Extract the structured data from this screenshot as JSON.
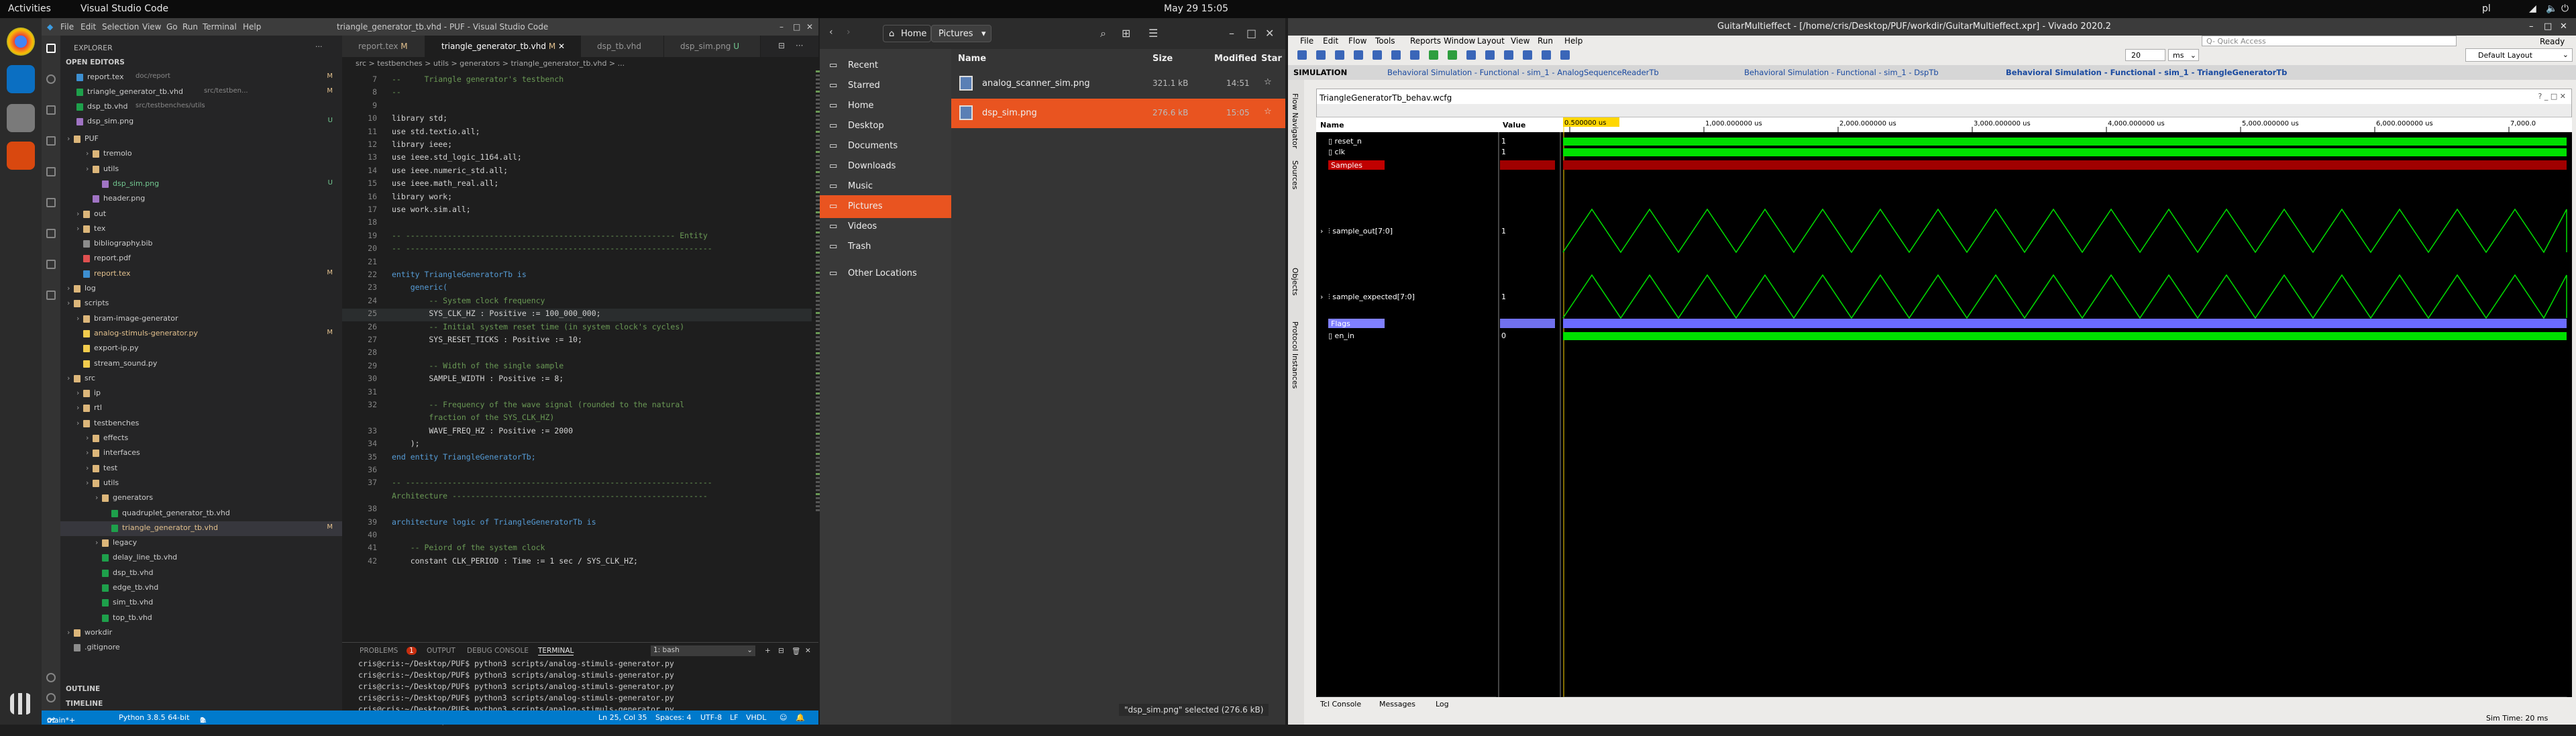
{
  "topbar": {
    "activities": "Activities",
    "app": "Visual Studio Code",
    "clock": "May 29  15:05",
    "locale": "pl"
  },
  "vscode": {
    "title": "triangle_generator_tb.vhd - PUF - Visual Studio Code",
    "menu": [
      "File",
      "Edit",
      "Selection",
      "View",
      "Go",
      "Run",
      "Terminal",
      "Help"
    ],
    "sidebar_title": "EXPLORER",
    "open_editors_header": "OPEN EDITORS",
    "open_editors": [
      {
        "name": "report.tex",
        "path": "doc/report",
        "badge": "M"
      },
      {
        "name": "triangle_generator_tb.vhd",
        "path": "src/testben...",
        "badge": "M"
      },
      {
        "name": "dsp_tb.vhd",
        "path": "src/testbenches/utils",
        "badge": ""
      },
      {
        "name": "dsp_sim.png",
        "path": "",
        "badge": "U"
      }
    ],
    "tree": [
      {
        "label": "PUF",
        "depth": 0,
        "kind": "folder"
      },
      {
        "label": "tremolo",
        "depth": 2,
        "kind": "folder"
      },
      {
        "label": "utils",
        "depth": 2,
        "kind": "folder"
      },
      {
        "label": "dsp_sim.png",
        "depth": 3,
        "kind": "png",
        "badge": "U"
      },
      {
        "label": "header.png",
        "depth": 2,
        "kind": "png"
      },
      {
        "label": "out",
        "depth": 1,
        "kind": "folder"
      },
      {
        "label": "tex",
        "depth": 1,
        "kind": "folder"
      },
      {
        "label": "bibliography.bib",
        "depth": 1,
        "kind": "file"
      },
      {
        "label": "report.pdf",
        "depth": 1,
        "kind": "pdf"
      },
      {
        "label": "report.tex",
        "depth": 1,
        "kind": "tex",
        "badge": "M"
      },
      {
        "label": "log",
        "depth": 0,
        "kind": "folder"
      },
      {
        "label": "scripts",
        "depth": 0,
        "kind": "folder"
      },
      {
        "label": "bram-image-generator",
        "depth": 1,
        "kind": "folder"
      },
      {
        "label": "analog-stimuls-generator.py",
        "depth": 1,
        "kind": "py",
        "badge": "M"
      },
      {
        "label": "export-ip.py",
        "depth": 1,
        "kind": "py"
      },
      {
        "label": "stream_sound.py",
        "depth": 1,
        "kind": "py"
      },
      {
        "label": "src",
        "depth": 0,
        "kind": "folder"
      },
      {
        "label": "ip",
        "depth": 1,
        "kind": "folder"
      },
      {
        "label": "rtl",
        "depth": 1,
        "kind": "folder"
      },
      {
        "label": "testbenches",
        "depth": 1,
        "kind": "folder"
      },
      {
        "label": "effects",
        "depth": 2,
        "kind": "folder"
      },
      {
        "label": "interfaces",
        "depth": 2,
        "kind": "folder"
      },
      {
        "label": "test",
        "depth": 2,
        "kind": "folder"
      },
      {
        "label": "utils",
        "depth": 2,
        "kind": "folder"
      },
      {
        "label": "generators",
        "depth": 3,
        "kind": "folder"
      },
      {
        "label": "quadruplet_generator_tb.vhd",
        "depth": 4,
        "kind": "vhd"
      },
      {
        "label": "triangle_generator_tb.vhd",
        "depth": 4,
        "kind": "vhd",
        "badge": "M",
        "selected": true
      },
      {
        "label": "legacy",
        "depth": 3,
        "kind": "folder"
      },
      {
        "label": "delay_line_tb.vhd",
        "depth": 3,
        "kind": "vhd"
      },
      {
        "label": "dsp_tb.vhd",
        "depth": 3,
        "kind": "vhd"
      },
      {
        "label": "edge_tb.vhd",
        "depth": 3,
        "kind": "vhd"
      },
      {
        "label": "sim_tb.vhd",
        "depth": 3,
        "kind": "vhd"
      },
      {
        "label": "top_tb.vhd",
        "depth": 3,
        "kind": "vhd"
      },
      {
        "label": "workdir",
        "depth": 0,
        "kind": "folder"
      },
      {
        "label": ".gitignore",
        "depth": 0,
        "kind": "file"
      }
    ],
    "outline": "OUTLINE",
    "timeline": "TIMELINE",
    "tabs": [
      {
        "label": "report.tex",
        "mod": "M"
      },
      {
        "label": "triangle_generator_tb.vhd",
        "mod": "M",
        "active": true
      },
      {
        "label": "dsp_tb.vhd",
        "mod": ""
      },
      {
        "label": "dsp_sim.png",
        "mod": "U"
      }
    ],
    "breadcrumb": "src > testbenches > utils > generators > triangle_generator_tb.vhd > ...",
    "code": [
      {
        "n": "7",
        "t": "--     Triangle generator's testbench",
        "c": "cm"
      },
      {
        "n": "8",
        "t": "--",
        "c": "cm"
      },
      {
        "n": "9",
        "t": "",
        "c": "tx"
      },
      {
        "n": "10",
        "t": "library std;",
        "c": "tx"
      },
      {
        "n": "11",
        "t": "use std.textio.all;",
        "c": "tx"
      },
      {
        "n": "12",
        "t": "library ieee;",
        "c": "tx"
      },
      {
        "n": "13",
        "t": "use ieee.std_logic_1164.all;",
        "c": "tx"
      },
      {
        "n": "14",
        "t": "use ieee.numeric_std.all;",
        "c": "tx"
      },
      {
        "n": "15",
        "t": "use ieee.math_real.all;",
        "c": "tx"
      },
      {
        "n": "16",
        "t": "library work;",
        "c": "tx"
      },
      {
        "n": "17",
        "t": "use work.sim.all;",
        "c": "tx"
      },
      {
        "n": "18",
        "t": "",
        "c": "tx"
      },
      {
        "n": "19",
        "t": "-- ---------------------------------------------------------- Entity",
        "c": "cm"
      },
      {
        "n": "20",
        "t": "-- ------------------------------------------------------------------",
        "c": "cm"
      },
      {
        "n": "21",
        "t": "",
        "c": "tx"
      },
      {
        "n": "22",
        "t": "entity TriangleGeneratorTb is",
        "c": "kw"
      },
      {
        "n": "23",
        "t": "    generic(",
        "c": "kw"
      },
      {
        "n": "24",
        "t": "        -- System clock frequency",
        "c": "cm"
      },
      {
        "n": "25",
        "t": "        SYS_CLK_HZ : Positive := 100_000_000;",
        "c": "tx"
      },
      {
        "n": "26",
        "t": "        -- Initial system reset time (in system clock's cycles)",
        "c": "cm"
      },
      {
        "n": "27",
        "t": "        SYS_RESET_TICKS : Positive := 10;",
        "c": "tx"
      },
      {
        "n": "28",
        "t": "",
        "c": "tx"
      },
      {
        "n": "29",
        "t": "        -- Width of the single sample",
        "c": "cm"
      },
      {
        "n": "30",
        "t": "        SAMPLE_WIDTH : Positive := 8;",
        "c": "tx"
      },
      {
        "n": "31",
        "t": "",
        "c": "tx"
      },
      {
        "n": "32",
        "t": "        -- Frequency of the wave signal (rounded to the natural",
        "c": "cm"
      },
      {
        "n": "",
        "t": "        fraction of the SYS_CLK_HZ)",
        "c": "cm"
      },
      {
        "n": "33",
        "t": "        WAVE_FREQ_HZ : Positive := 2000",
        "c": "tx"
      },
      {
        "n": "34",
        "t": "    );",
        "c": "tx"
      },
      {
        "n": "35",
        "t": "end entity TriangleGeneratorTb;",
        "c": "kw"
      },
      {
        "n": "36",
        "t": "",
        "c": "tx"
      },
      {
        "n": "37",
        "t": "-- ------------------------------------------------------------------",
        "c": "cm"
      },
      {
        "n": "",
        "t": "Architecture -------------------------------------------------------",
        "c": "cm"
      },
      {
        "n": "38",
        "t": "",
        "c": "tx"
      },
      {
        "n": "39",
        "t": "architecture logic of TriangleGeneratorTb is",
        "c": "kw"
      },
      {
        "n": "40",
        "t": "",
        "c": "tx"
      },
      {
        "n": "41",
        "t": "    -- Peiord of the system clock",
        "c": "cm"
      },
      {
        "n": "42",
        "t": "    constant CLK_PERIOD : Time := 1 sec / SYS_CLK_HZ;",
        "c": "tx"
      }
    ],
    "panel_tabs": [
      "PROBLEMS",
      "OUTPUT",
      "DEBUG CONSOLE",
      "TERMINAL"
    ],
    "problems_count": "1",
    "terminal_select": "1: bash",
    "terminal": [
      "cris@cris:~/Desktop/PUF$ python3 scripts/analog-stimuls-generator.py",
      "cris@cris:~/Desktop/PUF$ python3 scripts/analog-stimuls-generator.py",
      "cris@cris:~/Desktop/PUF$ python3 scripts/analog-stimuls-generator.py",
      "cris@cris:~/Desktop/PUF$ python3 scripts/analog-stimuls-generator.py",
      "cris@cris:~/Desktop/PUF$ python3 scripts/analog-stimuls-generator.py",
      "cris@cris:~/Desktop/PUF$ "
    ],
    "status": {
      "branch": "main*+",
      "python": "Python 3.8.5 64-bit",
      "errors": "0",
      "warnings": "1",
      "position": "Ln 25, Col 35",
      "spaces": "Spaces: 4",
      "encoding": "UTF-8",
      "eol": "LF",
      "lang": "VHDL"
    }
  },
  "nautilus": {
    "home": "Home",
    "pictures": "Pictures",
    "sidebar": [
      "Recent",
      "Starred",
      "Home",
      "Desktop",
      "Documents",
      "Downloads",
      "Music",
      "Pictures",
      "Videos",
      "Trash",
      "Other Locations"
    ],
    "cols": [
      "Name",
      "Size",
      "Modified",
      "Star"
    ],
    "files": [
      {
        "name": "analog_scanner_sim.png",
        "size": "321.1 kB",
        "modified": "14:51"
      },
      {
        "name": "dsp_sim.png",
        "size": "276.6 kB",
        "modified": "15:05"
      }
    ],
    "status": "\"dsp_sim.png\" selected  (276.6 kB)"
  },
  "vivado": {
    "title": "GuitarMultieffect - [/home/cris/Desktop/PUF/workdir/GuitarMultieffect.xpr] - Vivado 2020.2",
    "ready": "Ready",
    "menu": [
      "File",
      "Edit",
      "Flow",
      "Tools",
      "Reports",
      "Window",
      "Layout",
      "View",
      "Run",
      "Help"
    ],
    "quick": "Q- Quick Access",
    "layout": "Default Layout",
    "sim_label": "SIMULATION",
    "sim_tabs": [
      "Behavioral Simulation - Functional - sim_1 - AnalogSequenceReaderTb",
      "Behavioral Simulation - Functional - sim_1 - DspTb",
      "Behavioral Simulation - Functional - sim_1 - TriangleGeneratorTb"
    ],
    "runtime": "20",
    "runtime_unit": "ms",
    "wcfg": "TriangleGeneratorTb_behav.wcfg",
    "side_tabs": [
      "Flow Navigator",
      "Sources",
      "Objects",
      "Protocol Instances"
    ],
    "wave_cols": [
      "Name",
      "Value"
    ],
    "cursor": "0.500000 us",
    "ruler": [
      "0.000000 us",
      "1,000.000000 us",
      "2,000.000000 us",
      "3,000.000000 us",
      "4,000.000000 us",
      "5,000.000000 us",
      "6,000.000000 us",
      "7,000.0"
    ],
    "signals": [
      {
        "name": "reset_n",
        "value": "1"
      },
      {
        "name": "clk",
        "value": "1"
      },
      {
        "name": "Samples",
        "value": "",
        "group": true
      },
      {
        "name": "sample_out[7:0]",
        "value": "1"
      },
      {
        "name": "sample_expected[7:0]",
        "value": "1"
      },
      {
        "name": "Flags",
        "value": "",
        "group": true
      },
      {
        "name": "en_in",
        "value": "0"
      }
    ],
    "bottom_tabs": [
      "Tcl Console",
      "Messages",
      "Log"
    ],
    "sim_time": "Sim Time: 20 ms"
  }
}
